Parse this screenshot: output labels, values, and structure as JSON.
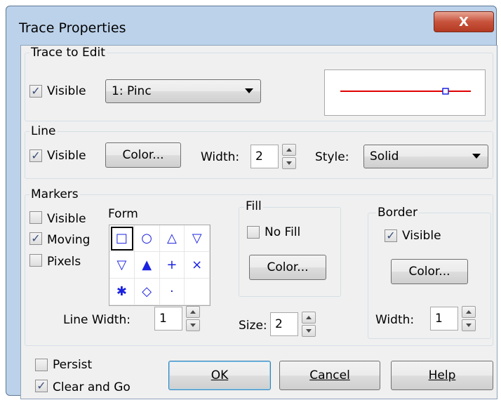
{
  "window": {
    "title": "Trace Properties",
    "close_label": "X"
  },
  "trace_group": {
    "legend": "Trace to Edit",
    "visible_label": "Visible",
    "visible_checked": true,
    "trace_select_value": "1:  Pinc",
    "preview_line_color": "#e00000",
    "preview_marker_color": "#1b22e0"
  },
  "line_group": {
    "legend": "Line",
    "visible_label": "Visible",
    "visible_checked": true,
    "color_button": "Color...",
    "width_label": "Width:",
    "width_value": "2",
    "style_label": "Style:",
    "style_value": "Solid"
  },
  "markers_group": {
    "legend": "Markers",
    "visible_label": "Visible",
    "visible_checked": false,
    "moving_label": "Moving",
    "moving_checked": true,
    "pixels_label": "Pixels",
    "pixels_checked": false,
    "form_label": "Form",
    "form_cells": [
      "□",
      "○",
      "△",
      "▽",
      "▽",
      "▲",
      "+",
      "×",
      "✱",
      "◇",
      "·",
      ""
    ],
    "line_width_label": "Line Width:",
    "line_width_value": "1",
    "size_label": "Size:",
    "size_value": "2",
    "fill": {
      "legend": "Fill",
      "no_fill_label": "No Fill",
      "no_fill_checked": false,
      "color_button": "Color..."
    },
    "border": {
      "legend": "Border",
      "visible_label": "Visible",
      "visible_checked": true,
      "color_button": "Color...",
      "width_label": "Width:",
      "width_value": "1"
    }
  },
  "footer": {
    "persist_label": "Persist",
    "persist_checked": false,
    "clear_go_label": "Clear and Go",
    "clear_go_checked": true,
    "ok_button": "OK",
    "cancel_button": "Cancel",
    "help_button": "Help"
  },
  "colors": {
    "accent_check": "#3a4f7a",
    "marker_blue": "#1b22e0",
    "trace_red": "#e00000"
  }
}
